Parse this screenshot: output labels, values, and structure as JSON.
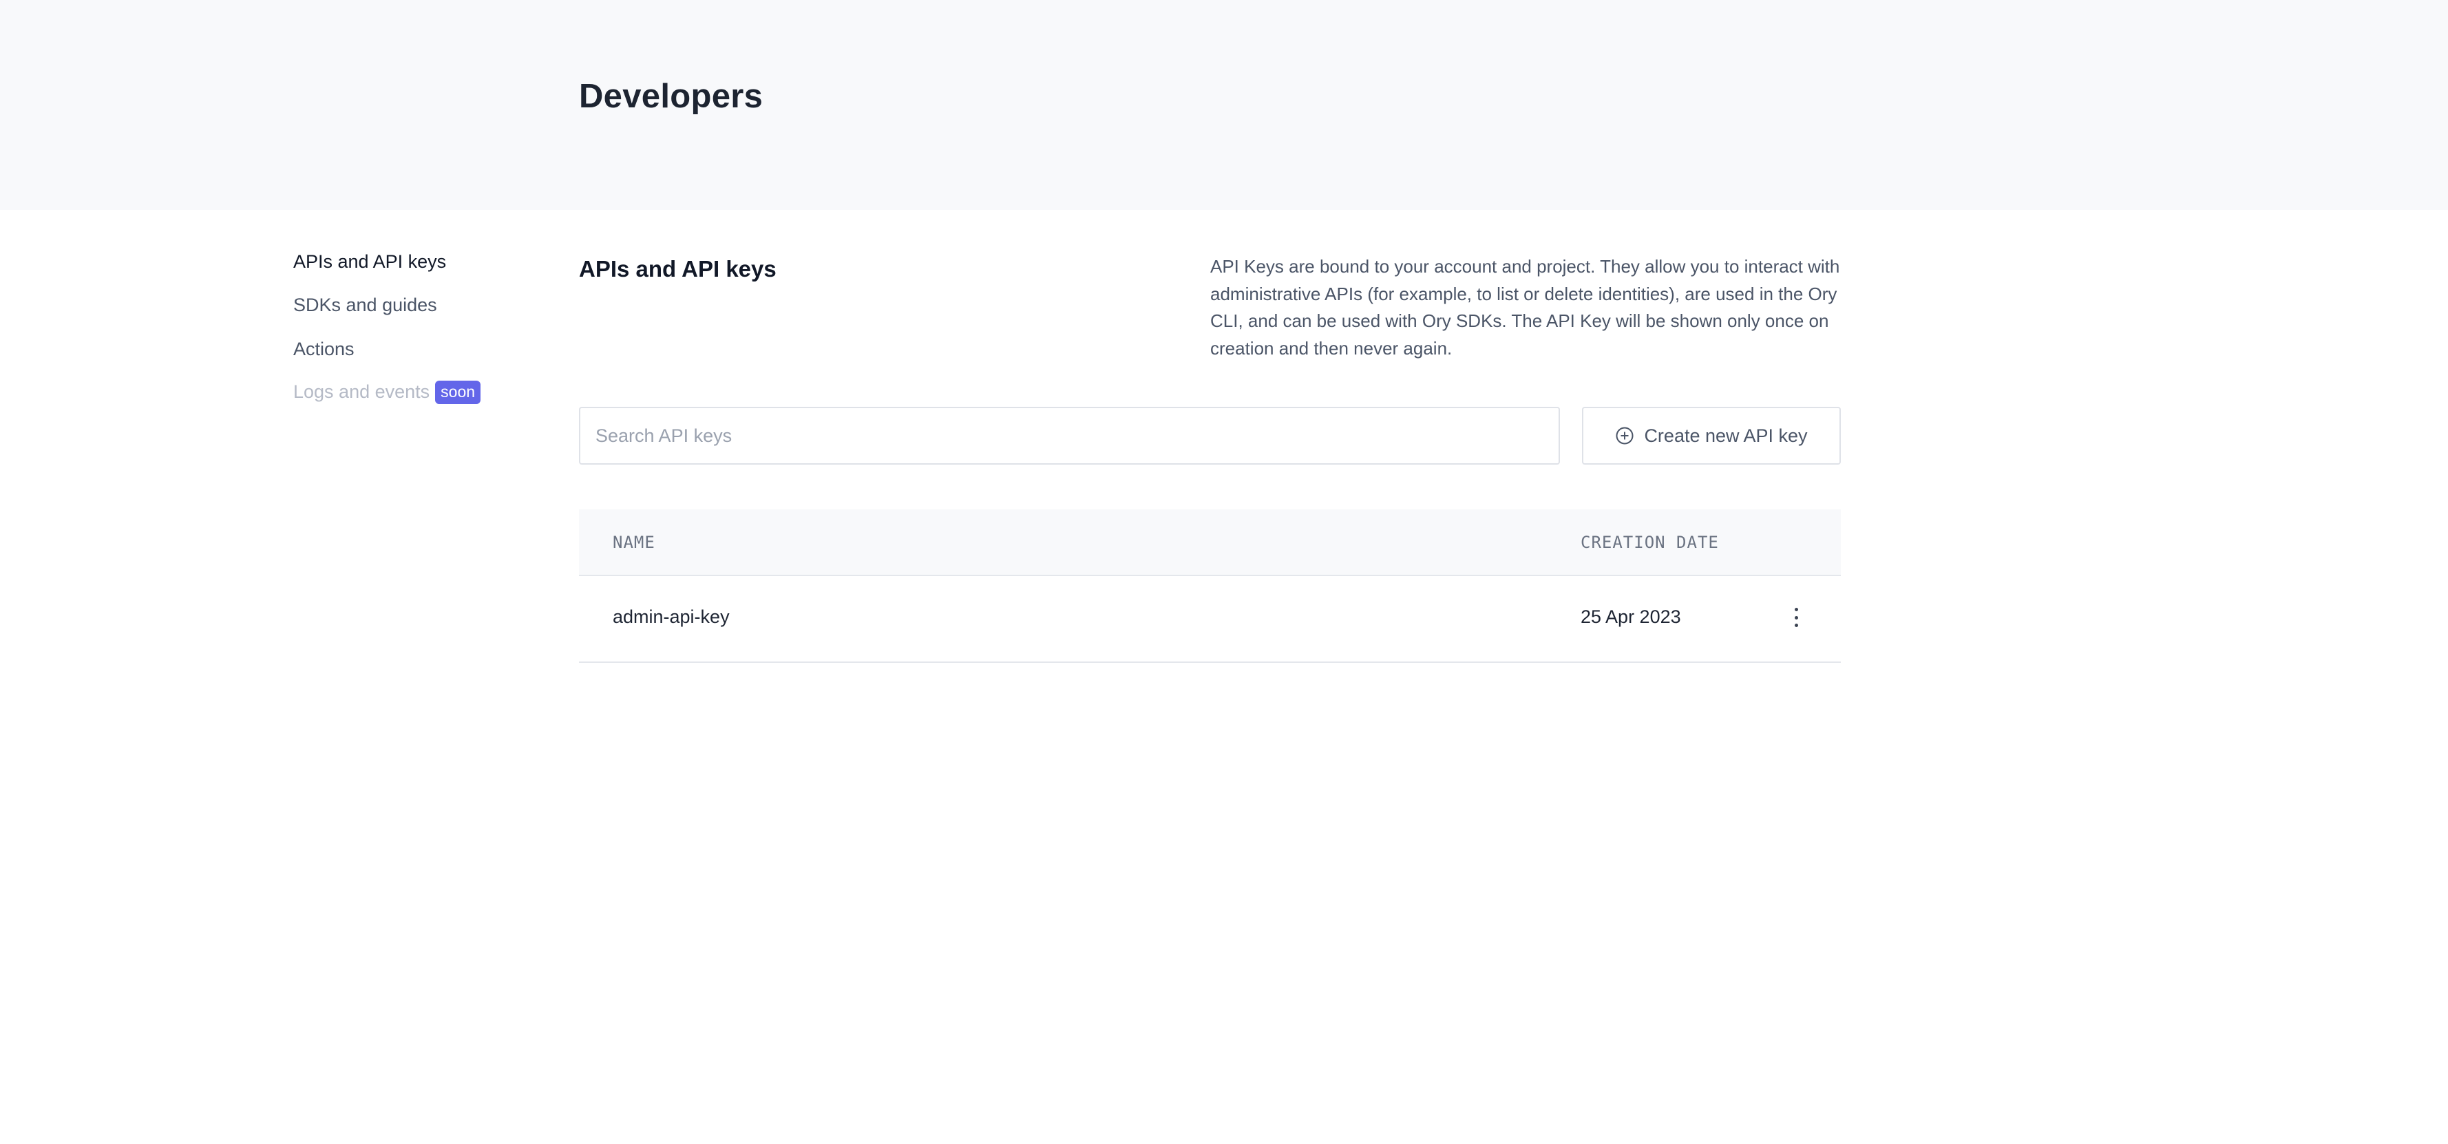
{
  "header": {
    "title": "Developers"
  },
  "sidebar": {
    "items": [
      {
        "label": "APIs and API keys",
        "state": "active"
      },
      {
        "label": "SDKs and guides",
        "state": "normal"
      },
      {
        "label": "Actions",
        "state": "normal"
      },
      {
        "label": "Logs and events",
        "state": "disabled",
        "badge": "soon"
      }
    ]
  },
  "section": {
    "title": "APIs and API keys",
    "description": "API Keys are bound to your account and project. They allow you to interact with administrative APIs (for example, to list or delete identities), are used in the Ory CLI, and can be used with Ory SDKs. The API Key will be shown only once on creation and then never again."
  },
  "search": {
    "placeholder": "Search API keys",
    "value": ""
  },
  "create_button": {
    "label": "Create new API key",
    "icon": "plus-circle-icon"
  },
  "table": {
    "columns": [
      "NAME",
      "CREATION DATE"
    ],
    "rows": [
      {
        "name": "admin-api-key",
        "creation_date": "25 Apr 2023",
        "menu_icon": "more-vertical-icon"
      }
    ]
  },
  "colors": {
    "header_band": "#f8f9fb",
    "badge": "#6366e9",
    "text_primary": "#111827",
    "text_secondary": "#4b5567",
    "text_disabled": "#b5bac6",
    "border": "#dfe2e8"
  }
}
